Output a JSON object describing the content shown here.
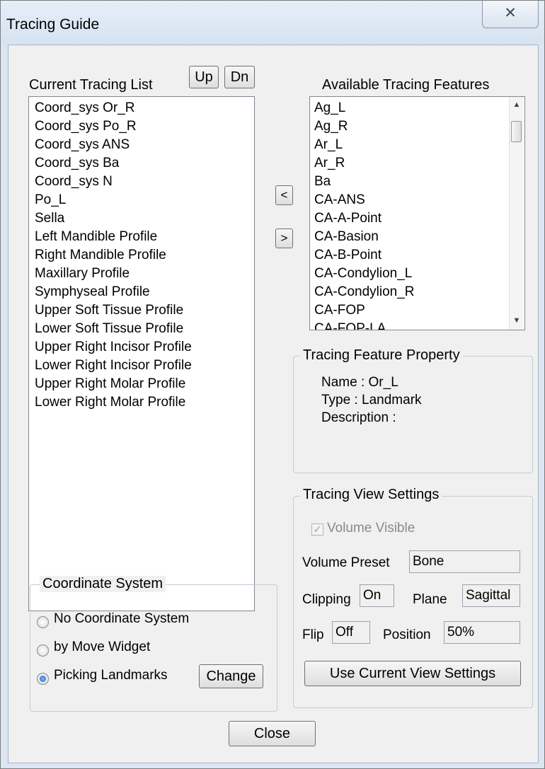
{
  "window": {
    "title": "Tracing Guide",
    "close_glyph": "✕"
  },
  "tracing_list": {
    "label": "Current Tracing List",
    "up_label": "Up",
    "down_label": "Dn",
    "items": [
      "Coord_sys Or_R",
      "Coord_sys Po_R",
      "Coord_sys ANS",
      "Coord_sys Ba",
      "Coord_sys N",
      "Po_L",
      "Sella",
      "Left Mandible Profile",
      "Right Mandible Profile",
      "Maxillary Profile",
      "Symphyseal Profile",
      "Upper Soft Tissue Profile",
      "Lower Soft Tissue Profile",
      "Upper Right Incisor Profile",
      "Lower Right Incisor Profile",
      "Upper Right Molar Profile",
      "Lower Right Molar Profile"
    ]
  },
  "transfer": {
    "left_label": "<",
    "right_label": ">"
  },
  "available": {
    "label": "Available Tracing Features",
    "items": [
      "Ag_L",
      "Ag_R",
      "Ar_L",
      "Ar_R",
      "Ba",
      "CA-ANS",
      "CA-A-Point",
      "CA-Basion",
      "CA-B-Point",
      "CA-Condylion_L",
      "CA-Condylion_R",
      "CA-FOP",
      "CA-FOP-LA"
    ],
    "scroll_up": "▲",
    "scroll_down": "▼"
  },
  "property": {
    "title": "Tracing Feature Property",
    "name": "Name : Or_L",
    "type": "Type : Landmark",
    "description": "Description :"
  },
  "view_settings": {
    "title": "Tracing View Settings",
    "volume_visible_label": "Volume Visible",
    "volume_visible_checked": true,
    "volume_preset_label": "Volume Preset",
    "volume_preset_value": "Bone",
    "clipping_label": "Clipping",
    "clipping_value": "On",
    "plane_label": "Plane",
    "plane_value": "Sagittal",
    "flip_label": "Flip",
    "flip_value": "Off",
    "position_label": "Position",
    "position_value": "50%",
    "use_current_label": "Use Current View Settings"
  },
  "coordinate_system": {
    "title": "Coordinate System",
    "options": [
      "No Coordinate System",
      "by Move Widget",
      "Picking Landmarks"
    ],
    "selected": "Picking Landmarks",
    "change_label": "Change"
  },
  "close_label": "Close"
}
